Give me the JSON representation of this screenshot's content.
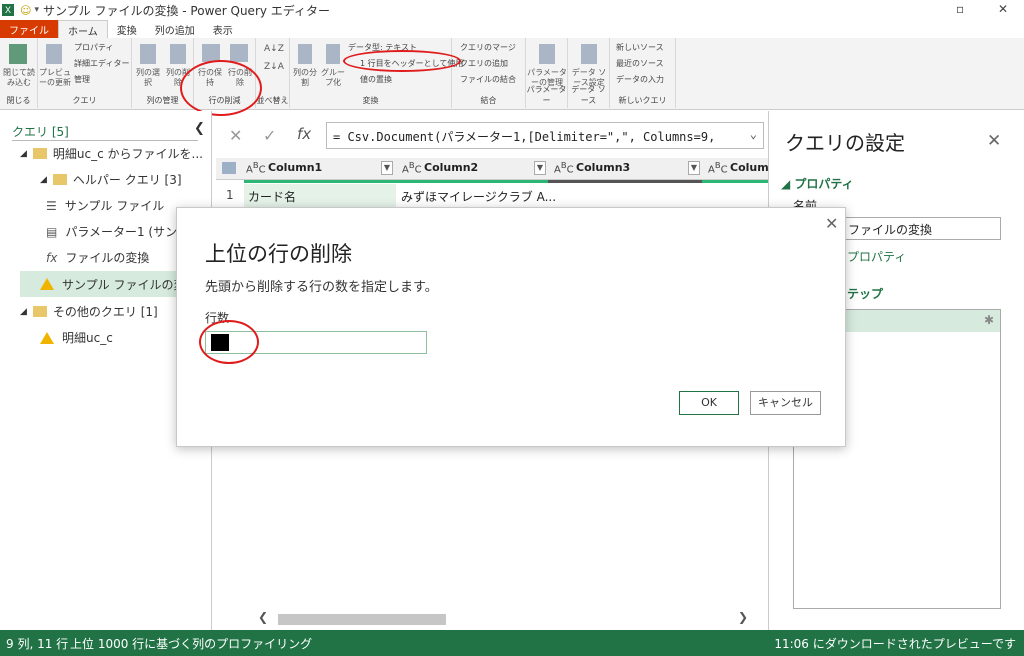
{
  "window": {
    "title": "サンプル ファイルの変換 - Power Query エディター"
  },
  "tabs": [
    "ファイル",
    "ホーム",
    "変換",
    "列の追加",
    "表示"
  ],
  "ribbon": {
    "close_load": "閉じて読み込む",
    "close_group": "閉じる",
    "preview_refresh": "プレビューの更新",
    "properties": "プロパティ",
    "advanced_editor": "詳細エディター",
    "manage": "管理",
    "query_group": "クエリ",
    "select_columns": "列の選択",
    "remove_columns": "列の削除",
    "manage_columns_group": "列の管理",
    "keep_rows": "行の保持",
    "remove_rows": "行の削除",
    "reduce_rows_group": "行の削減",
    "sort_group": "並べ替え",
    "split_column": "列の分割",
    "group_by": "グループ化",
    "data_type": "データ型: テキスト",
    "use_first_row": "1 行目をヘッダーとして使用",
    "replace_values": "値の置換",
    "transform_group": "変換",
    "merge_queries": "クエリのマージ",
    "append_queries": "クエリの追加",
    "combine_files": "ファイルの結合",
    "combine_group": "結合",
    "manage_params": "パラメーターの管理",
    "params_group": "パラメーター",
    "datasource_settings": "データ ソース設定",
    "datasource_group": "データ ソース",
    "new_source": "新しいソース",
    "recent_sources": "最近のソース",
    "enter_data": "データの入力",
    "new_query_group": "新しいクエリ"
  },
  "queries_pane": {
    "header": "クエリ [5]",
    "items": [
      {
        "label": "明細uc_c からファイルを..."
      },
      {
        "label": "ヘルパー クエリ [3]"
      },
      {
        "label": "サンプル ファイル"
      },
      {
        "label": "パラメーター1 (サン"
      },
      {
        "label": "ファイルの変換"
      },
      {
        "label": "サンプル ファイルの変"
      },
      {
        "label": "その他のクエリ [1]"
      },
      {
        "label": "明細uc_c"
      }
    ]
  },
  "formula": {
    "fx": "fx",
    "text": "= Csv.Document(パラメーター1,[Delimiter=\",\", Columns=9,"
  },
  "grid": {
    "columns": [
      "Column1",
      "Column2",
      "Column3",
      "Column"
    ],
    "row1": {
      "num": "1",
      "c1": "カード名",
      "c2": "みずほマイレージクラブ A..."
    }
  },
  "settings_pane": {
    "title": "クエリの設定",
    "properties_header": "プロパティ",
    "name_label": "名前",
    "name_value": "ファイルの変換",
    "all_properties": "プロパティ",
    "steps_header": "テップ"
  },
  "dialog": {
    "title": "上位の行の削除",
    "description": "先頭から削除する行の数を指定します。",
    "field_label": "行数",
    "field_value": "",
    "ok": "OK",
    "cancel": "キャンセル",
    "close": "✕"
  },
  "status": {
    "left1": "9 列, 11 行",
    "left2": "上位 1000 行に基づく列のプロファイリング",
    "right": "11:06 にダウンロードされたプレビューです"
  },
  "colors": {
    "accent": "#217346",
    "file_tab": "#d83b01",
    "highlight": "#e01b1b"
  }
}
